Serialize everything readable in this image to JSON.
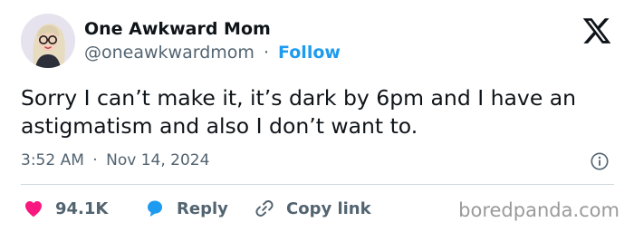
{
  "author": {
    "name": "One Awkward Mom",
    "handle": "@oneawkwardmom",
    "separator": "·",
    "follow_label": "Follow"
  },
  "tweet": {
    "text": "Sorry I can’t make it, it’s dark by 6pm and I have an astigmatism and also I don’t want to.",
    "time": "3:52 AM",
    "separator": "·",
    "date": "Nov 14, 2024"
  },
  "actions": {
    "likes_count": "94.1K",
    "reply_label": "Reply",
    "copy_link_label": "Copy link"
  },
  "watermark": "boredpanda.com",
  "icons": {
    "platform_logo": "x-logo-icon",
    "info": "info-icon",
    "like": "heart-icon",
    "reply": "speech-bubble-icon",
    "copy_link": "link-icon"
  },
  "colors": {
    "text": "#0f1419",
    "secondary_text": "#536471",
    "follow": "#1d9bf0",
    "like": "#f91880",
    "reply": "#1d9bf0",
    "divider": "#cfd9de",
    "watermark": "#9a9a9a"
  }
}
